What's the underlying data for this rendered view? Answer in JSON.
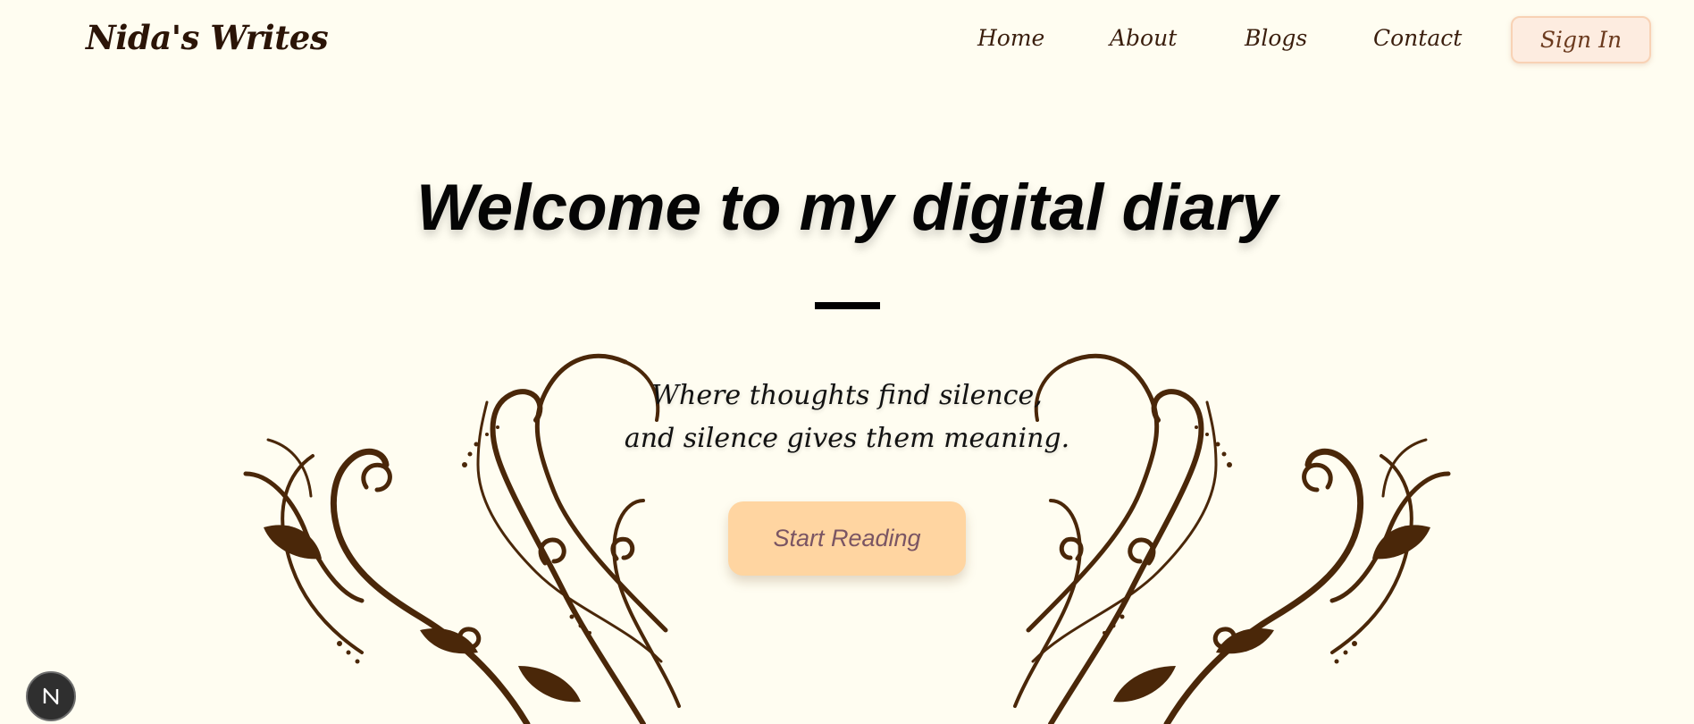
{
  "brand": {
    "name": "Nida's Writes"
  },
  "nav": {
    "items": [
      {
        "label": "Home"
      },
      {
        "label": "About"
      },
      {
        "label": "Blogs"
      },
      {
        "label": "Contact"
      }
    ],
    "signin_label": "Sign In"
  },
  "hero": {
    "title": "Welcome to my digital diary",
    "subtitle_line1": "Where thoughts find silence,",
    "subtitle_line2": "and silence gives them meaning.",
    "cta_label": "Start Reading"
  },
  "colors": {
    "background": "#fffdf1",
    "brand_text": "#2b1407",
    "signin_bg": "#fdece0",
    "signin_border": "#f8d2b5",
    "cta_bg": "#ffd5a1",
    "cta_text": "#7a5563",
    "ornament": "#4a2709"
  },
  "icons": {
    "dev_badge": "nextjs-logo-icon",
    "decoration": "floral-swirl-ornament"
  }
}
